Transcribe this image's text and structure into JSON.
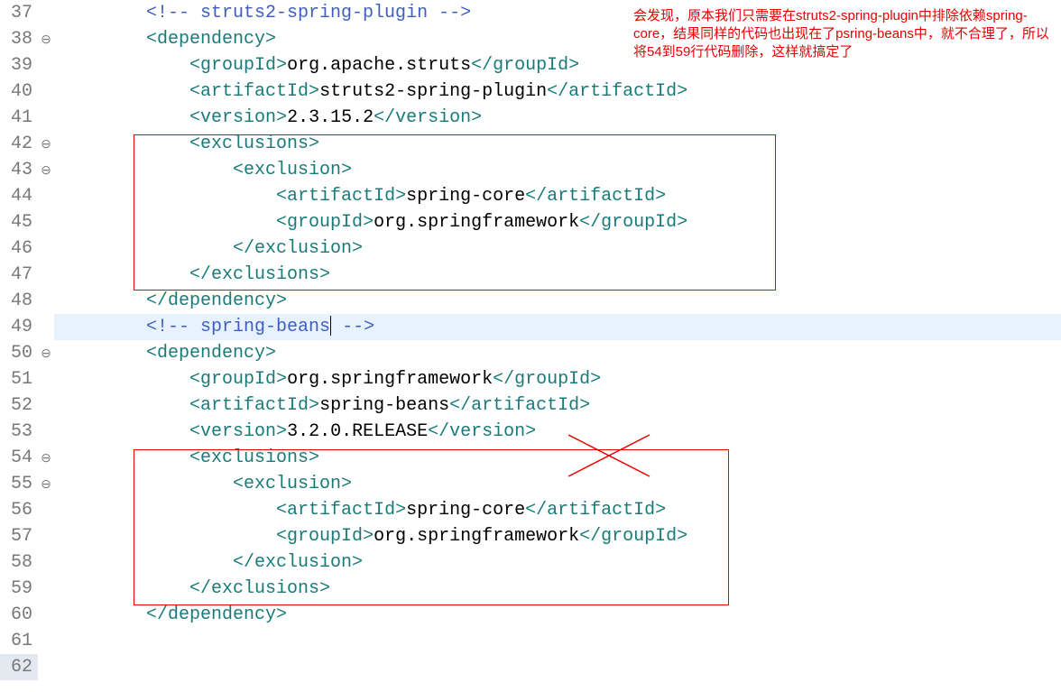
{
  "annotation": "会发现，原本我们只需要在struts2-spring-plugin中排除依赖spring-core，结果同样的代码也出现在了psring-beans中，就不合理了，所以将54到59行代码删除，这样就搞定了",
  "lines": [
    {
      "n": 37,
      "fold": "",
      "indent": 2,
      "active": false,
      "tokens": [
        {
          "cls": "comment",
          "t": "<!-- struts2-spring-plugin -->"
        }
      ]
    },
    {
      "n": 38,
      "fold": "⊖",
      "indent": 2,
      "active": false,
      "tokens": [
        {
          "cls": "tag",
          "t": "<dependency>"
        }
      ]
    },
    {
      "n": 39,
      "fold": "",
      "indent": 3,
      "active": false,
      "tokens": [
        {
          "cls": "tag",
          "t": "<groupId>"
        },
        {
          "cls": "text",
          "t": "org.apache.struts"
        },
        {
          "cls": "tag",
          "t": "</groupId>"
        }
      ]
    },
    {
      "n": 40,
      "fold": "",
      "indent": 3,
      "active": false,
      "tokens": [
        {
          "cls": "tag",
          "t": "<artifactId>"
        },
        {
          "cls": "text",
          "t": "struts2-spring-plugin"
        },
        {
          "cls": "tag",
          "t": "</artifactId>"
        }
      ]
    },
    {
      "n": 41,
      "fold": "",
      "indent": 3,
      "active": false,
      "tokens": [
        {
          "cls": "tag",
          "t": "<version>"
        },
        {
          "cls": "text",
          "t": "2.3.15.2"
        },
        {
          "cls": "tag",
          "t": "</version>"
        }
      ]
    },
    {
      "n": 42,
      "fold": "⊖",
      "indent": 3,
      "active": false,
      "tokens": [
        {
          "cls": "tag",
          "t": "<exclusions>"
        }
      ]
    },
    {
      "n": 43,
      "fold": "⊖",
      "indent": 4,
      "active": false,
      "tokens": [
        {
          "cls": "tag",
          "t": "<exclusion>"
        }
      ]
    },
    {
      "n": 44,
      "fold": "",
      "indent": 5,
      "active": false,
      "tokens": [
        {
          "cls": "tag",
          "t": "<artifactId>"
        },
        {
          "cls": "text",
          "t": "spring-core"
        },
        {
          "cls": "tag",
          "t": "</artifactId>"
        }
      ]
    },
    {
      "n": 45,
      "fold": "",
      "indent": 5,
      "active": false,
      "tokens": [
        {
          "cls": "tag",
          "t": "<groupId>"
        },
        {
          "cls": "text",
          "t": "org.springframework"
        },
        {
          "cls": "tag",
          "t": "</groupId>"
        }
      ]
    },
    {
      "n": 46,
      "fold": "",
      "indent": 4,
      "active": false,
      "tokens": [
        {
          "cls": "tag",
          "t": "</exclusion>"
        }
      ]
    },
    {
      "n": 47,
      "fold": "",
      "indent": 3,
      "active": false,
      "tokens": [
        {
          "cls": "tag",
          "t": "</exclusions>"
        }
      ]
    },
    {
      "n": 48,
      "fold": "",
      "indent": 2,
      "active": false,
      "tokens": [
        {
          "cls": "tag",
          "t": "</dependency>"
        }
      ]
    },
    {
      "n": 49,
      "fold": "",
      "indent": 2,
      "active": true,
      "caret_after": 2,
      "tokens": [
        {
          "cls": "comment",
          "t": "<!-- "
        },
        {
          "cls": "comment",
          "t": "spring-beans"
        },
        {
          "cls": "comment",
          "t": " -->"
        }
      ]
    },
    {
      "n": 50,
      "fold": "⊖",
      "indent": 2,
      "active": false,
      "tokens": [
        {
          "cls": "tag",
          "t": "<dependency>"
        }
      ]
    },
    {
      "n": 51,
      "fold": "",
      "indent": 3,
      "active": false,
      "tokens": [
        {
          "cls": "tag",
          "t": "<groupId>"
        },
        {
          "cls": "text",
          "t": "org.springframework"
        },
        {
          "cls": "tag",
          "t": "</groupId>"
        }
      ]
    },
    {
      "n": 52,
      "fold": "",
      "indent": 3,
      "active": false,
      "tokens": [
        {
          "cls": "tag",
          "t": "<artifactId>"
        },
        {
          "cls": "text",
          "t": "spring-beans"
        },
        {
          "cls": "tag",
          "t": "</artifactId>"
        }
      ]
    },
    {
      "n": 53,
      "fold": "",
      "indent": 3,
      "active": false,
      "tokens": [
        {
          "cls": "tag",
          "t": "<version>"
        },
        {
          "cls": "text",
          "t": "3.2.0.RELEASE"
        },
        {
          "cls": "tag",
          "t": "</version>"
        }
      ]
    },
    {
      "n": 54,
      "fold": "⊖",
      "indent": 3,
      "active": false,
      "tokens": [
        {
          "cls": "tag",
          "t": "<exclusions>"
        }
      ]
    },
    {
      "n": 55,
      "fold": "⊖",
      "indent": 4,
      "active": false,
      "tokens": [
        {
          "cls": "tag",
          "t": "<exclusion>"
        }
      ]
    },
    {
      "n": 56,
      "fold": "",
      "indent": 5,
      "active": false,
      "tokens": [
        {
          "cls": "tag",
          "t": "<artifactId>"
        },
        {
          "cls": "text",
          "t": "spring-core"
        },
        {
          "cls": "tag",
          "t": "</artifactId>"
        }
      ]
    },
    {
      "n": 57,
      "fold": "",
      "indent": 5,
      "active": false,
      "tokens": [
        {
          "cls": "tag",
          "t": "<groupId>"
        },
        {
          "cls": "text",
          "t": "org.springframework"
        },
        {
          "cls": "tag",
          "t": "</groupId>"
        }
      ]
    },
    {
      "n": 58,
      "fold": "",
      "indent": 4,
      "active": false,
      "tokens": [
        {
          "cls": "tag",
          "t": "</exclusion>"
        }
      ]
    },
    {
      "n": 59,
      "fold": "",
      "indent": 3,
      "active": false,
      "tokens": [
        {
          "cls": "tag",
          "t": "</exclusions>"
        }
      ]
    },
    {
      "n": 60,
      "fold": "",
      "indent": 2,
      "active": false,
      "tokens": [
        {
          "cls": "tag",
          "t": "</dependency>"
        }
      ]
    },
    {
      "n": 61,
      "fold": "",
      "indent": 0,
      "active": false,
      "tokens": []
    },
    {
      "n": 62,
      "fold": "",
      "indent": 0,
      "active": false,
      "tokens": [],
      "gutter_hl": true
    }
  ]
}
